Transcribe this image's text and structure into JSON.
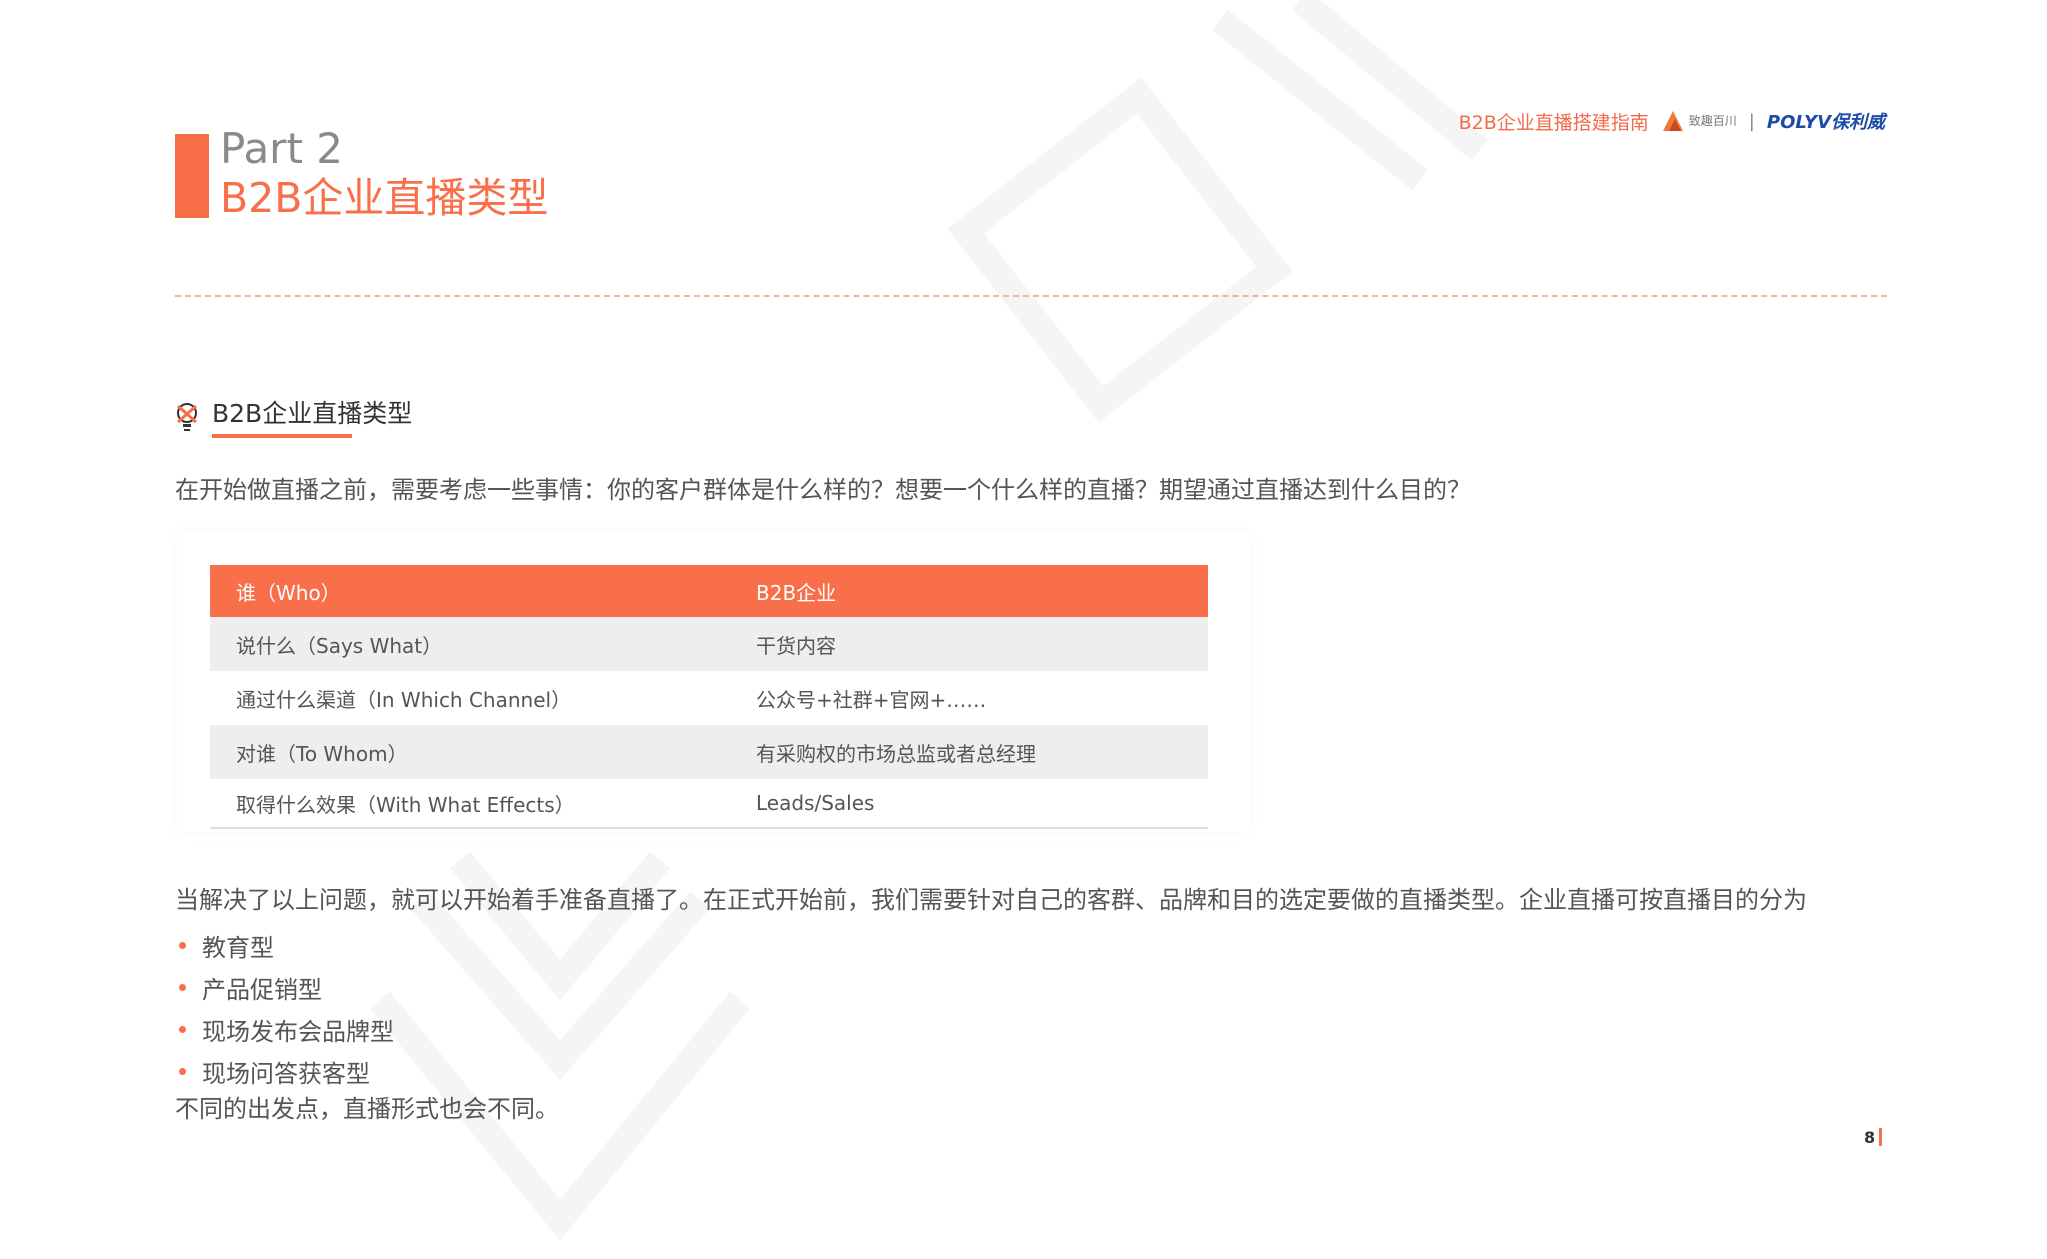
{
  "header": {
    "brand_title": "B2B企业直播搭建指南",
    "partner_logo_text": "致趣百川",
    "separator": "|",
    "polyv_logo": "POLYV保利威"
  },
  "part": {
    "number": "Part 2",
    "title": "B2B企业直播类型"
  },
  "section": {
    "icon": "bulb-icon",
    "title": "B2B企业直播类型"
  },
  "intro": "在开始做直播之前，需要考虑一些事情：你的客户群体是什么样的？想要一个什么样的直播？期望通过直播达到什么目的？",
  "table": {
    "header": [
      "谁（Who）",
      "B2B企业"
    ],
    "rows": [
      [
        "说什么（Says What）",
        "干货内容"
      ],
      [
        "通过什么渠道（In Which Channel）",
        "公众号+社群+官网+……"
      ],
      [
        "对谁（To Whom）",
        "有采购权的市场总监或者总经理"
      ],
      [
        "取得什么效果（With What Effects）",
        "Leads/Sales"
      ]
    ]
  },
  "paragraph2": "当解决了以上问题，就可以开始着手准备直播了。在正式开始前，我们需要针对自己的客群、品牌和目的选定要做的直播类型。企业直播可按直播目的分为",
  "bullets": [
    "教育型",
    "产品促销型",
    "现场发布会品牌型",
    "现场问答获客型"
  ],
  "closing": "不同的出发点，直播形式也会不同。",
  "page_number": "8",
  "colors": {
    "accent": "#f86f49",
    "polyv_blue": "#1e4ba8",
    "row_gray": "#eeeeee"
  }
}
